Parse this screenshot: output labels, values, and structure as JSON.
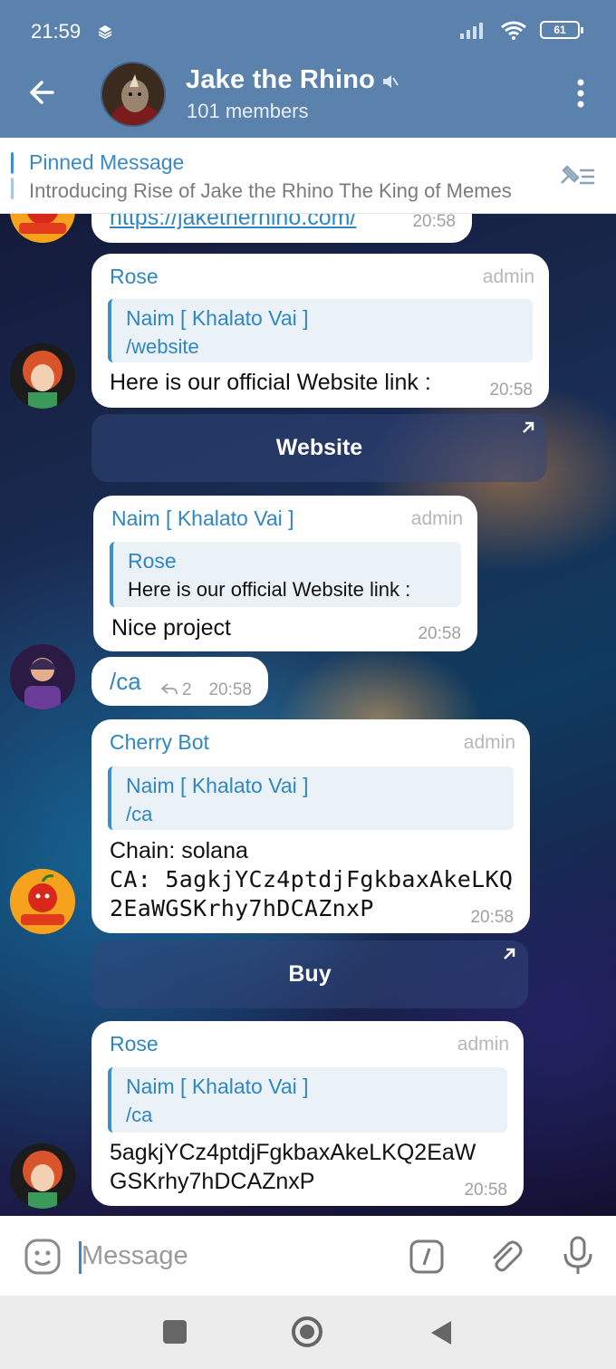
{
  "status_bar": {
    "time": "21:59",
    "battery": "61"
  },
  "header": {
    "title": "Jake the Rhino",
    "subtitle": "101 members"
  },
  "pinned": {
    "title": "Pinned Message",
    "text": "Introducing Rise of Jake the Rhino The King of Memes"
  },
  "messages": [
    {
      "body": "https://jaketherhino.com/",
      "time": "20:58"
    },
    {
      "author": "Rose",
      "role": "admin",
      "reply_name": "Naim [ Khalato Vai ]",
      "reply_text": "/website",
      "body": "Here is our official Website link :",
      "time": "20:58",
      "button": "Website"
    },
    {
      "author": "Naim [ Khalato Vai ]",
      "role": "admin",
      "reply_name": "Rose",
      "reply_text": "Here is our official Website link :",
      "body": "Nice project",
      "time": "20:58"
    },
    {
      "body": "/ca",
      "replies": "2",
      "time": "20:58"
    },
    {
      "author": "Cherry Bot",
      "role": "admin",
      "reply_name": "Naim [ Khalato Vai ]",
      "reply_text": "/ca",
      "body_line1": "Chain: solana",
      "body_line2": "CA: 5agkjYCz4ptdjFgkbaxAkeLKQ",
      "body_line3": "2EaWGSKrhy7hDCAZnxP",
      "time": "20:58",
      "button": "Buy"
    },
    {
      "author": "Rose",
      "role": "admin",
      "reply_name": "Naim [ Khalato Vai ]",
      "reply_text": "/ca",
      "body_line1": "5agkjYCz4ptdjFgkbaxAkeLKQ2EaW",
      "body_line2": "GSKrhy7hDCAZnxP",
      "time": "20:58"
    }
  ],
  "input": {
    "placeholder": "Message"
  },
  "colors": {
    "header": "#5b82ad",
    "accent": "#2f86c2",
    "bubble": "#ffffff"
  }
}
